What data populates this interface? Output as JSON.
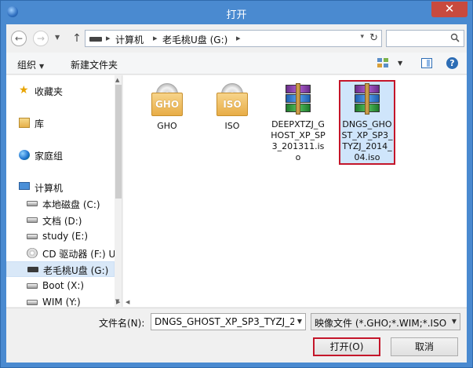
{
  "window": {
    "title": "打开",
    "close_glyph": "✕"
  },
  "nav": {
    "back_glyph": "←",
    "forward_glyph": "→",
    "recent_glyph": "▼",
    "up_glyph": "↑"
  },
  "address": {
    "crumbs": [
      "计算机",
      "老毛桃U盘 (G:)"
    ],
    "sep": "▸",
    "drop_glyph": "▾",
    "refresh_glyph": "↻"
  },
  "toolbar": {
    "organize": "组织",
    "new_folder": "新建文件夹",
    "caret": "▼",
    "help_glyph": "?"
  },
  "sidebar": {
    "items": [
      {
        "label": "收藏夹",
        "icon": "star-icon"
      },
      {
        "label": "库",
        "icon": "library-icon"
      },
      {
        "label": "家庭组",
        "icon": "homegroup-icon"
      },
      {
        "label": "计算机",
        "icon": "computer-icon"
      },
      {
        "label": "本地磁盘 (C:)",
        "icon": "drive-icon"
      },
      {
        "label": "文档 (D:)",
        "icon": "drive-icon"
      },
      {
        "label": "study (E:)",
        "icon": "drive-icon"
      },
      {
        "label": "CD 驱动器 (F:) U",
        "icon": "cd-drive-icon"
      },
      {
        "label": "老毛桃U盘 (G:)",
        "icon": "usb-drive-icon",
        "selected": true
      },
      {
        "label": "Boot (X:)",
        "icon": "drive-icon"
      },
      {
        "label": "WIM (Y:)",
        "icon": "drive-icon"
      }
    ],
    "star_glyph": "★",
    "scroll_up": "▲",
    "scroll_down": "▼"
  },
  "files": [
    {
      "name": "GHO",
      "badge": "GHO",
      "type": "folder"
    },
    {
      "name": "ISO",
      "badge": "ISO",
      "type": "folder"
    },
    {
      "name": "DEEPXTZJ_GHOST_XP_SP3_201311.iso",
      "type": "archive"
    },
    {
      "name": "DNGS_GHOST_XP_SP3_TYZJ_2014_04.iso",
      "type": "archive",
      "selected": true
    }
  ],
  "bottom": {
    "scroll_left": "◀",
    "scroll_right": "▶",
    "filename_label": "文件名(N):",
    "filename_value": "DNGS_GHOST_XP_SP3_TYZJ_20",
    "filetype_value": "映像文件 (*.GHO;*.WIM;*.ISO",
    "drop_glyph": "▼",
    "open_label": "打开(O)",
    "cancel_label": "取消"
  },
  "colors": {
    "accent": "#c4162a",
    "titlebar": "#4a8ad0",
    "selection": "#cfe5fb"
  }
}
